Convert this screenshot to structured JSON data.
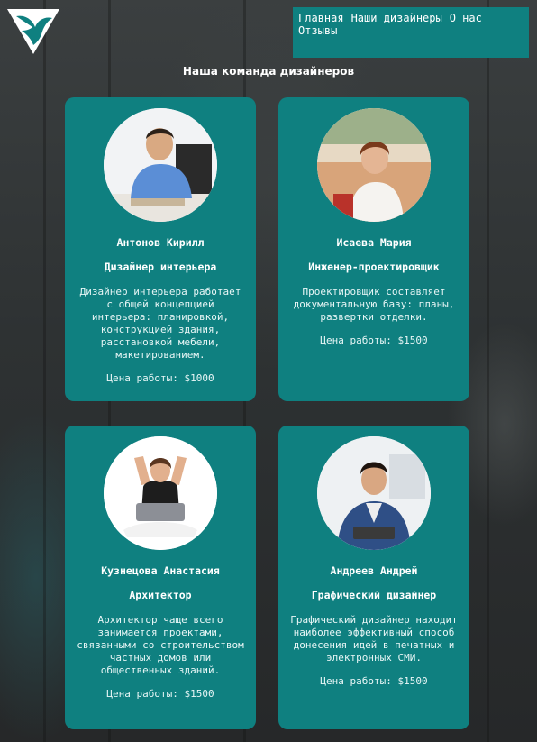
{
  "nav": {
    "items": [
      "Главная",
      "Наши дизайнеры",
      "О нас",
      "Отзывы"
    ]
  },
  "page_title": "Наша команда дизайнеров",
  "designers": [
    {
      "name": "Антонов Кирилл",
      "role": "Дизайнер интерьера",
      "description": "Дизайнер интерьера работает с общей концепцией интерьера: планировкой, конструкцией здания, расстановкой мебели, макетированием.",
      "price": "Цена работы: $1000"
    },
    {
      "name": "Исаева Мария",
      "role": "Инженер-проектировщик",
      "description": "Проектировщик составляет документальную базу: планы, развертки отделки.",
      "price": "Цена работы: $1500"
    },
    {
      "name": "Кузнецова Анастасия",
      "role": "Архитектор",
      "description": "Архитектор чаще всего занимается проектами, связанными со строительством частных домов или общественных зданий.",
      "price": "Цена работы: $1500"
    },
    {
      "name": "Андреев Андрей",
      "role": "Графический дизайнер",
      "description": "Графический дизайнер находит наиболее эффективный способ донесения идей в печатных и электронных СМИ.",
      "price": "Цена работы: $1500"
    }
  ],
  "colors": {
    "accent": "#0f8080",
    "text": "#ffffff",
    "background": "#2e3233"
  },
  "icons": {
    "logo": "bird-logo-icon"
  }
}
